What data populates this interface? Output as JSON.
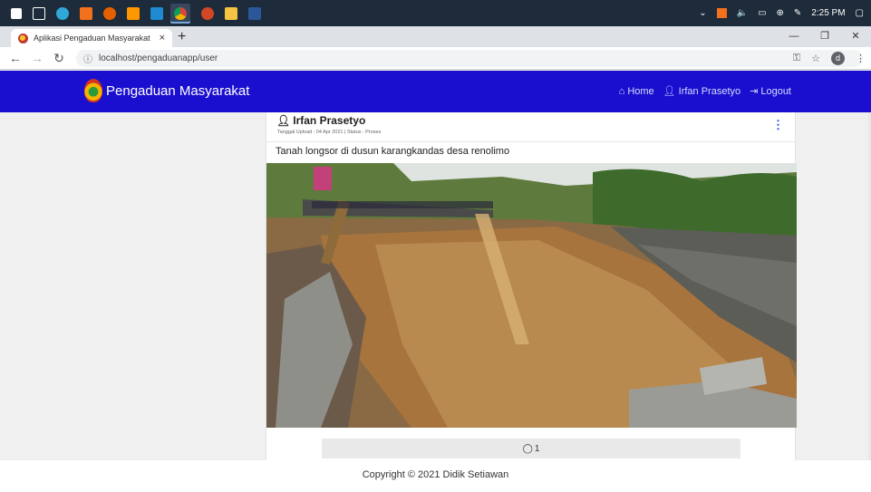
{
  "browser": {
    "tab_title": "Aplikasi Pengaduan Masyarakat",
    "tab_close": "×",
    "new_tab": "+",
    "url": "localhost/pengaduanapp/user",
    "profile_initial": "d"
  },
  "taskbar": {
    "time": "2:25 PM"
  },
  "navbar": {
    "brand": "Pengaduan Masyarakat",
    "links": [
      {
        "label": "Home",
        "icon": "home-icon"
      },
      {
        "label": "Irfan Prasetyo",
        "icon": "user-icon"
      },
      {
        "label": "Logout",
        "icon": "logout-icon"
      }
    ]
  },
  "post": {
    "author": "Irfan Prasetyo",
    "meta": "Tanggal Upload : 04 Apr 2021 | Status : Proses",
    "caption": "Tanah longsor di dusun karangkandas desa renolimo",
    "comment_count": "1"
  },
  "footer": {
    "copyright": "Copyright © 2021 Didik Setiawan"
  },
  "colors": {
    "navbar": "#1a0fcf",
    "accent": "#2d4fe0"
  }
}
